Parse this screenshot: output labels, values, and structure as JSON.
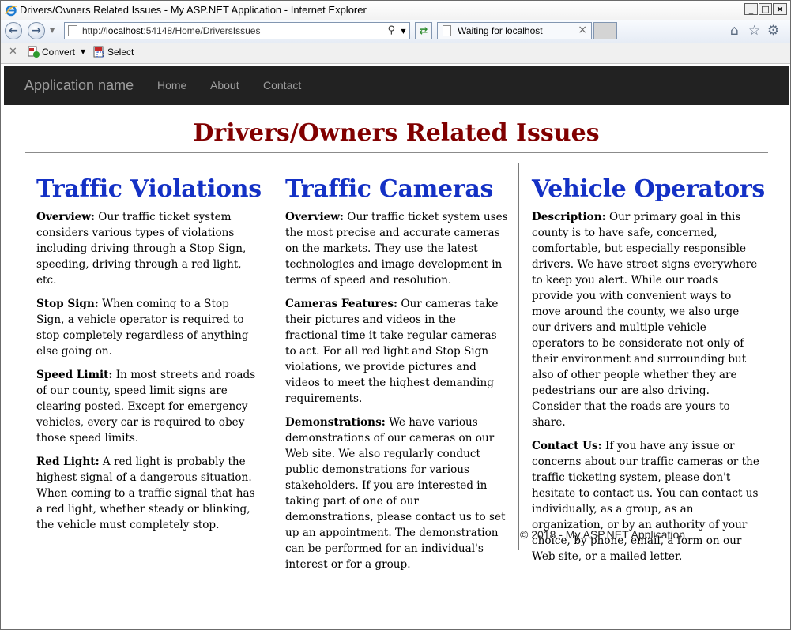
{
  "window": {
    "title": "Drivers/Owners Related Issues - My ASP.NET Application - Internet Explorer",
    "controls": {
      "minimize": "_",
      "maximize": "□",
      "close": "×"
    }
  },
  "browser": {
    "address_prefix": "http://",
    "address_host": "localhost",
    "address_rest": ":54148/Home/DriversIssues",
    "tab_label": "Waiting for localhost",
    "icons": [
      "back-arrow-icon",
      "forward-arrow-icon",
      "refresh-icon",
      "home-icon",
      "favorites-star-icon",
      "settings-gear-icon"
    ]
  },
  "command_bar": {
    "convert_label": "Convert",
    "select_label": "Select"
  },
  "site": {
    "brand": "Application name",
    "nav": [
      "Home",
      "About",
      "Contact"
    ],
    "page_title": "Drivers/Owners Related Issues",
    "columns": [
      {
        "heading": "Traffic Violations",
        "paragraphs": [
          {
            "label": "Overview:",
            "text": " Our traffic ticket system considers various types of violations including driving through a Stop Sign, speeding, driving through a red light, etc."
          },
          {
            "label": "Stop Sign:",
            "text": " When coming to a Stop Sign, a vehicle operator is required to stop completely regardless of anything else going on."
          },
          {
            "label": "Speed Limit:",
            "text": " In most streets and roads of our county, speed limit signs are clearing posted. Except for emergency vehicles, every car is required to obey those speed limits."
          },
          {
            "label": "Red Light:",
            "text": " A red light is probably the highest signal of a dangerous situation. When coming to a traffic signal that has a red light, whether steady or blinking, the vehicle must completely stop."
          }
        ]
      },
      {
        "heading": "Traffic Cameras",
        "paragraphs": [
          {
            "label": "Overview:",
            "text": " Our traffic ticket system uses the most precise and accurate cameras on the markets. They use the latest technologies and image development in terms of speed and resolution."
          },
          {
            "label": "Cameras Features:",
            "text": " Our cameras take their pictures and videos in the fractional time it take regular cameras to act. For all red light and Stop Sign violations, we provide pictures and videos to meet the highest demanding requirements."
          },
          {
            "label": "Demonstrations:",
            "text": " We have various demonstrations of our cameras on our Web site. We also regularly conduct public demonstrations for various stakeholders. If you are interested in taking part of one of our demonstrations, please contact us to set up an appointment. The demonstration can be performed for an individual's interest or for a group."
          }
        ]
      },
      {
        "heading": "Vehicle Operators",
        "paragraphs": [
          {
            "label": "Description:",
            "text": " Our primary goal in this county is to have safe, concerned, comfortable, but especially responsible drivers. We have street signs everywhere to keep you alert. While our roads provide you with convenient ways to move around the county, we also urge our drivers and multiple vehicle operators to be considerate not only of their environment and surrounding but also of other people whether they are pedestrians our are also driving. Consider that the roads are yours to share."
          },
          {
            "label": "Contact Us:",
            "text": " If you have any issue or concerns about our traffic cameras or the traffic ticketing system, please don't hesitate to contact us. You can contact us individually, as a group, as an organization, or by an authority of your choice, by phone, email, a form on our Web site, or a mailed letter."
          }
        ]
      }
    ],
    "footer": "© 2018 - My ASP.NET Application"
  },
  "colors": {
    "page_title": "#800000",
    "column_heading": "#1431C5",
    "navbar_bg": "#222222",
    "navbar_text": "#9D9D9D"
  }
}
